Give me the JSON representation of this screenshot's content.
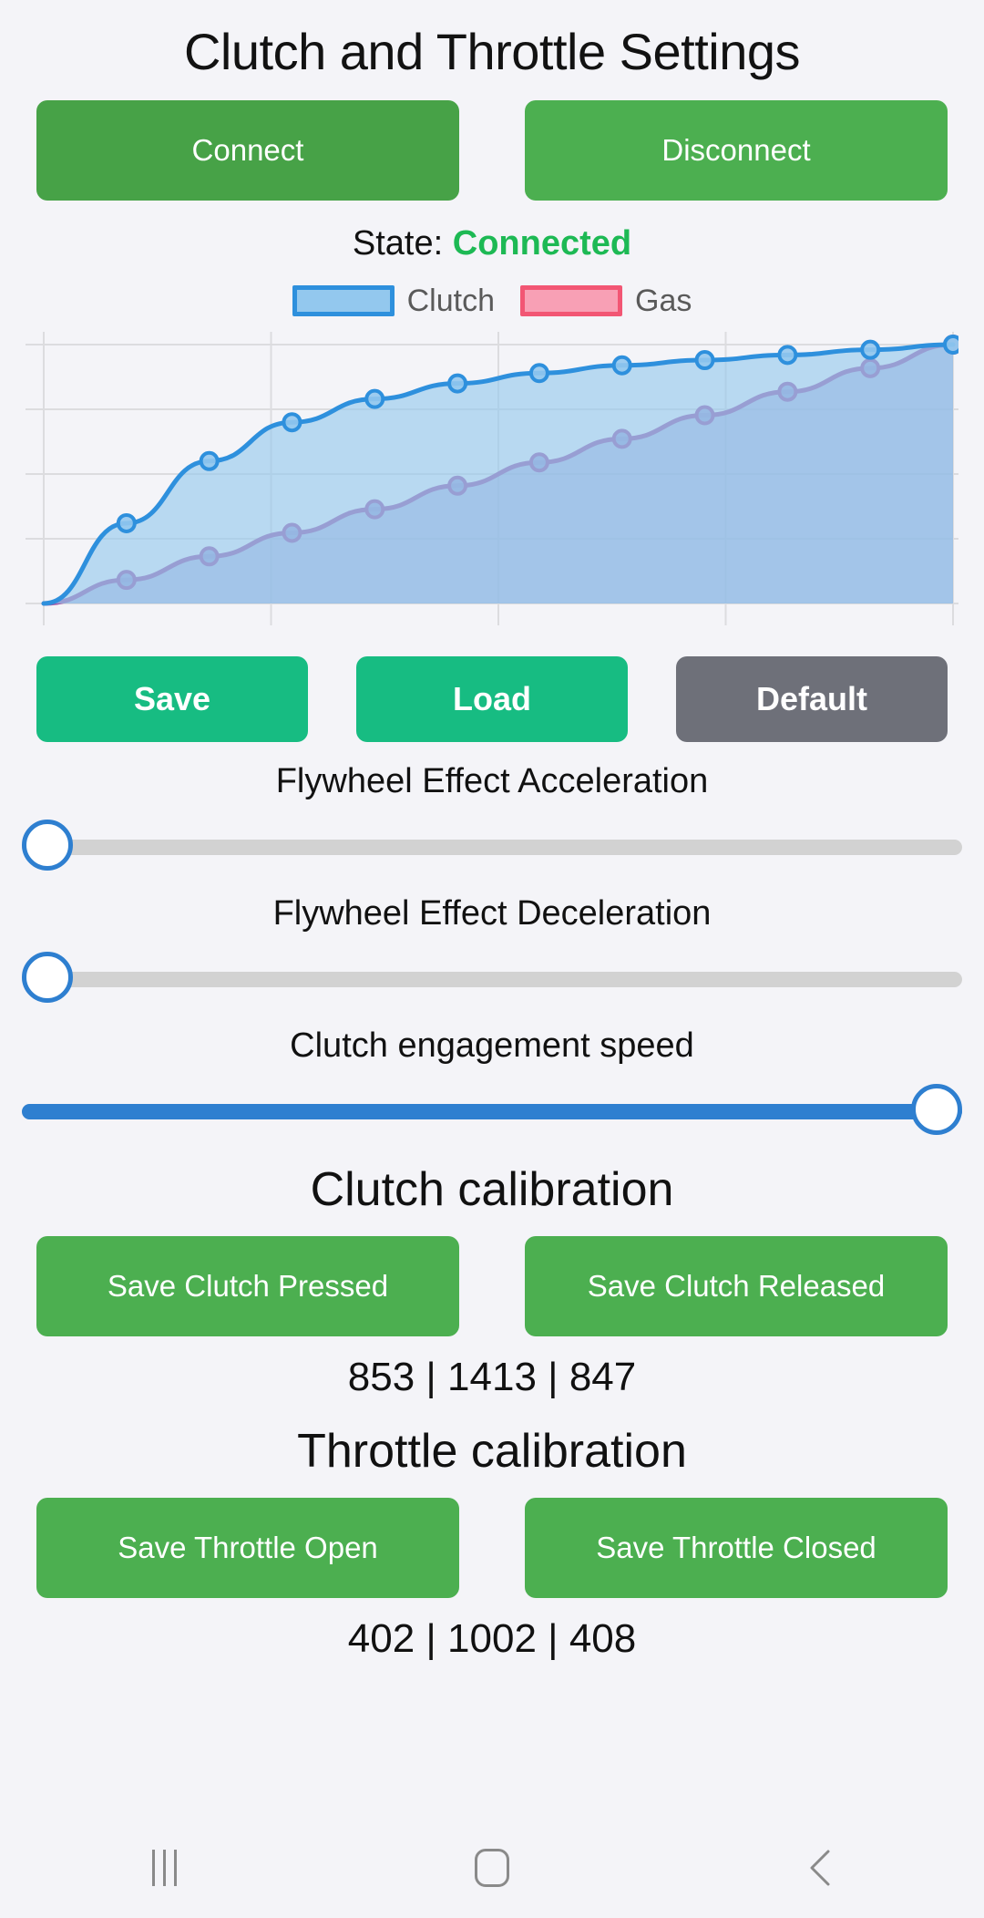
{
  "header": {
    "title": "Clutch and Throttle Settings"
  },
  "connection": {
    "connect_label": "Connect",
    "disconnect_label": "Disconnect",
    "state_prefix": "State:",
    "state_value": "Connected",
    "state_color": "#1db954"
  },
  "legend": {
    "clutch_label": "Clutch",
    "gas_label": "Gas",
    "clutch_color": "#2e90dd",
    "clutch_fill": "#93c8ee",
    "gas_color": "#f25674",
    "gas_fill": "#f8a0b5"
  },
  "actions": {
    "save_label": "Save",
    "load_label": "Load",
    "default_label": "Default",
    "save_color": "#17bc82",
    "default_color": "#6e7079"
  },
  "sliders": [
    {
      "label": "Flywheel Effect Acceleration",
      "value": 0,
      "min": 0,
      "max": 100
    },
    {
      "label": "Flywheel Effect Deceleration",
      "value": 0,
      "min": 0,
      "max": 100
    },
    {
      "label": "Clutch engagement speed",
      "value": 100,
      "min": 0,
      "max": 100
    }
  ],
  "clutch_calibration": {
    "title": "Clutch calibration",
    "pressed_label": "Save Clutch Pressed",
    "released_label": "Save Clutch Released",
    "values": "853 | 1413 | 847"
  },
  "throttle_calibration": {
    "title": "Throttle calibration",
    "open_label": "Save Throttle Open",
    "closed_label": "Save Throttle Closed",
    "values": "402 | 1002 | 408"
  },
  "navbar": {
    "recents": "recents-icon",
    "home": "home-icon",
    "back": "back-icon"
  },
  "chart_data": {
    "type": "line",
    "title": "",
    "xlabel": "",
    "ylabel": "",
    "xlim": [
      0,
      100
    ],
    "ylim": [
      0,
      100
    ],
    "grid": true,
    "legend_position": "top",
    "x": [
      0,
      9.1,
      18.2,
      27.3,
      36.4,
      45.5,
      54.5,
      63.6,
      72.7,
      81.8,
      90.9,
      100
    ],
    "series": [
      {
        "name": "Clutch",
        "color": "#2e90dd",
        "fill": "#93c8ee",
        "values": [
          0,
          31,
          55,
          70,
          79,
          85,
          89,
          92,
          94,
          96,
          98,
          100
        ]
      },
      {
        "name": "Gas",
        "color": "#a05ba8",
        "fill": "#9b9fd4",
        "values": [
          0,
          9.1,
          18.2,
          27.3,
          36.4,
          45.5,
          54.5,
          63.6,
          72.7,
          81.8,
          90.9,
          100
        ]
      }
    ]
  }
}
